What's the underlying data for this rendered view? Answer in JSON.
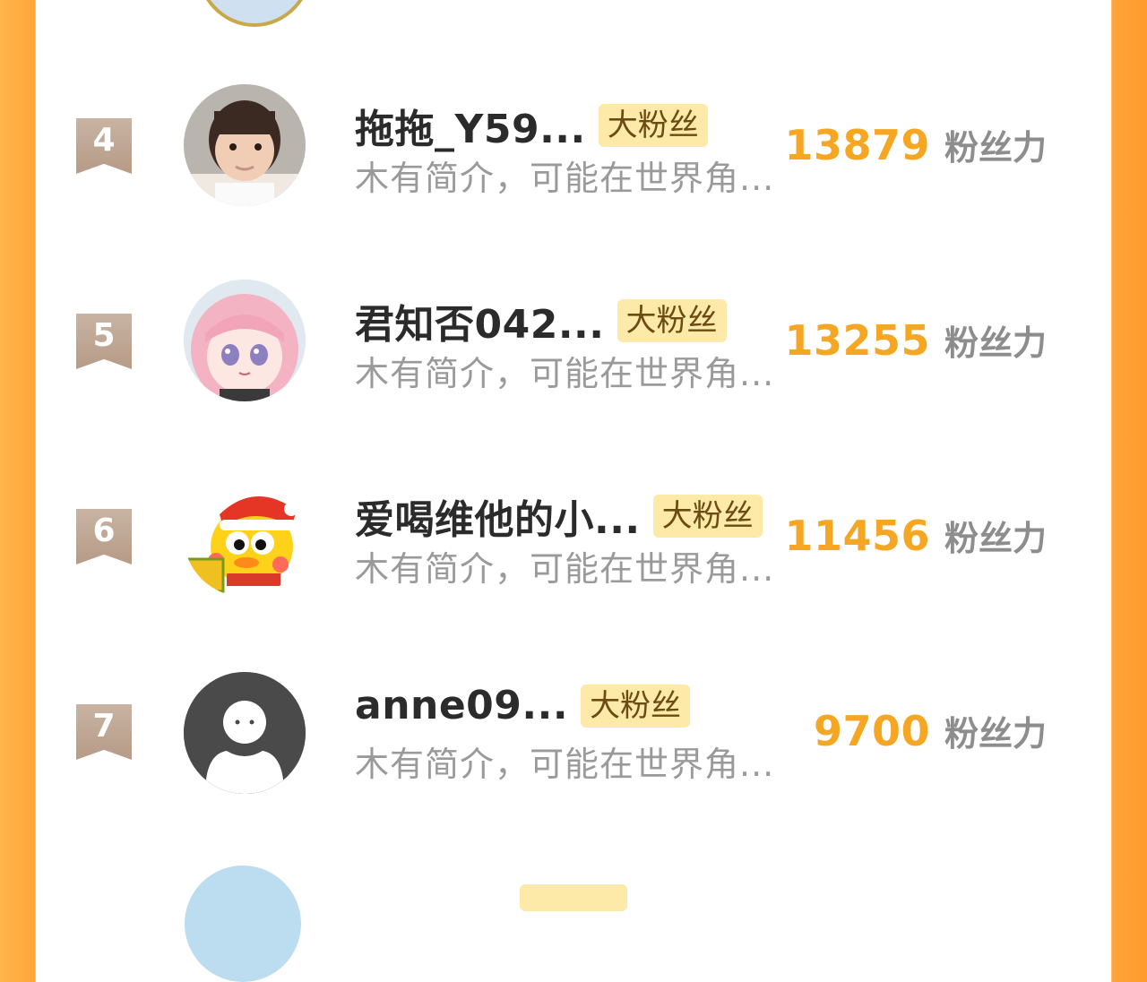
{
  "badge_label": "大粉丝",
  "score_label": "粉丝力",
  "bio_text": "木有简介，可能在世界角...",
  "entries": [
    {
      "rank": "4",
      "name": "拖拖_Y59...",
      "score": "13879",
      "avatar": "child-photo"
    },
    {
      "rank": "5",
      "name": "君知否042...",
      "score": "13255",
      "avatar": "anime-girl"
    },
    {
      "rank": "6",
      "name": "爱喝维他的小...",
      "score": "11456",
      "avatar": "cartoon-duck"
    },
    {
      "rank": "7",
      "name": "anne09...",
      "score": "9700",
      "avatar": "default-ghost"
    }
  ],
  "colors": {
    "accent_orange": "#f5a623",
    "badge_bg": "#fde9a8",
    "rank_ribbon": "#c0a895"
  }
}
